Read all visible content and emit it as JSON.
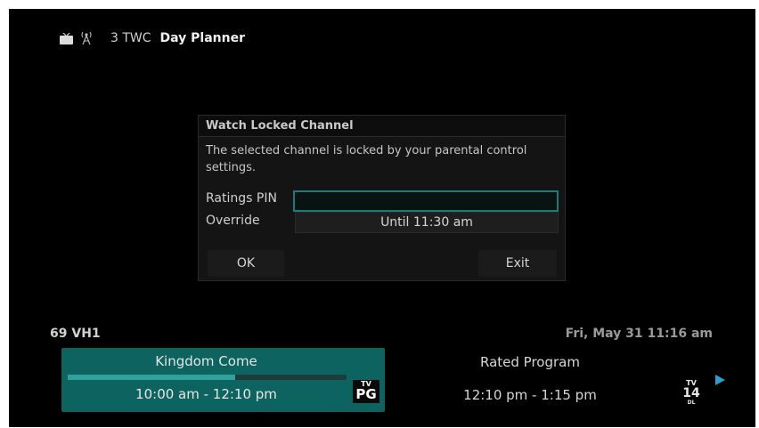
{
  "topbar": {
    "channel": "3 TWC",
    "title": "Day Planner",
    "icons": [
      "tv-icon",
      "antenna-icon"
    ]
  },
  "dialog": {
    "title": "Watch Locked Channel",
    "message": "The selected channel is locked by your parental control settings.",
    "pin_label": "Ratings PIN",
    "pin_value": "",
    "override_label": "Override",
    "override_value": "Until 11:30 am",
    "ok_label": "OK",
    "exit_label": "Exit"
  },
  "info": {
    "channel": "69 VH1",
    "datetime": "Fri, May 31 11:16 am",
    "current": {
      "title": "Kingdom Come",
      "time": "10:00 am - 12:10 pm",
      "progress": 0.6,
      "rating_tv": "TV",
      "rating_code": "PG"
    },
    "next": {
      "title": "Rated Program",
      "time": "12:10 pm - 1:15 pm",
      "rating_tv": "TV",
      "rating_code": "14",
      "rating_sub": "DL"
    }
  },
  "colors": {
    "accent": "#0c6360",
    "focus_border": "#1c7a78",
    "arrow": "#2a9fd3"
  }
}
